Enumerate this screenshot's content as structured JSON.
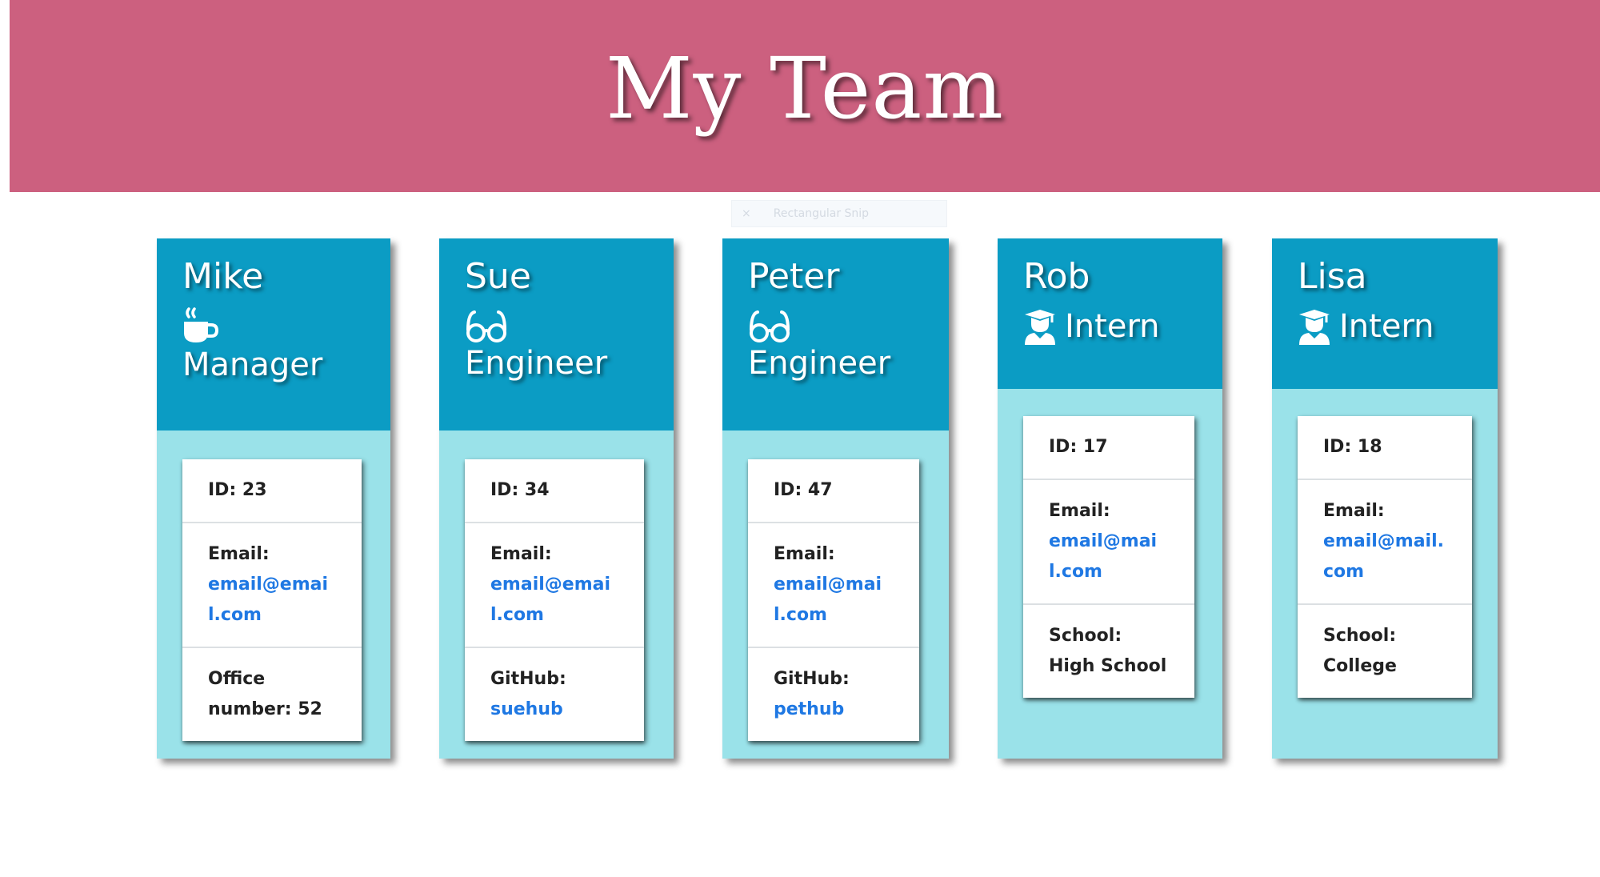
{
  "header": {
    "title": "My Team"
  },
  "overlay": {
    "snip_label": "Rectangular Snip",
    "close_glyph": "×"
  },
  "team": [
    {
      "name": "Mike",
      "role": "Manager",
      "role_icon": "coffee-icon",
      "id_label": "ID: 23",
      "email_label": "Email:",
      "email": "email@email.com",
      "extra_label": "Office number: 52",
      "extra_value": ""
    },
    {
      "name": "Sue",
      "role": "Engineer",
      "role_icon": "glasses-icon",
      "id_label": "ID: 34",
      "email_label": "Email:",
      "email": "email@email.com",
      "extra_label": "GitHub:",
      "extra_value": "suehub"
    },
    {
      "name": "Peter",
      "role": "Engineer",
      "role_icon": "glasses-icon",
      "id_label": "ID: 47",
      "email_label": "Email:",
      "email": "email@mail.com",
      "extra_label": "GitHub:",
      "extra_value": "pethub"
    },
    {
      "name": "Rob",
      "role": "Intern",
      "role_icon": "graduate-icon",
      "id_label": "ID: 17",
      "email_label": "Email:",
      "email": "email@mail.com",
      "extra_label": "School: High School",
      "extra_value": ""
    },
    {
      "name": "Lisa",
      "role": "Intern",
      "role_icon": "graduate-icon",
      "id_label": "ID: 18",
      "email_label": "Email:",
      "email": "email@mail.com",
      "extra_label": "School: College",
      "extra_value": ""
    }
  ],
  "colors": {
    "header_bg": "#cc607f",
    "card_head_bg": "#0b9cc4",
    "card_body_bg": "#9ae2e9",
    "link": "#1f78e3"
  }
}
